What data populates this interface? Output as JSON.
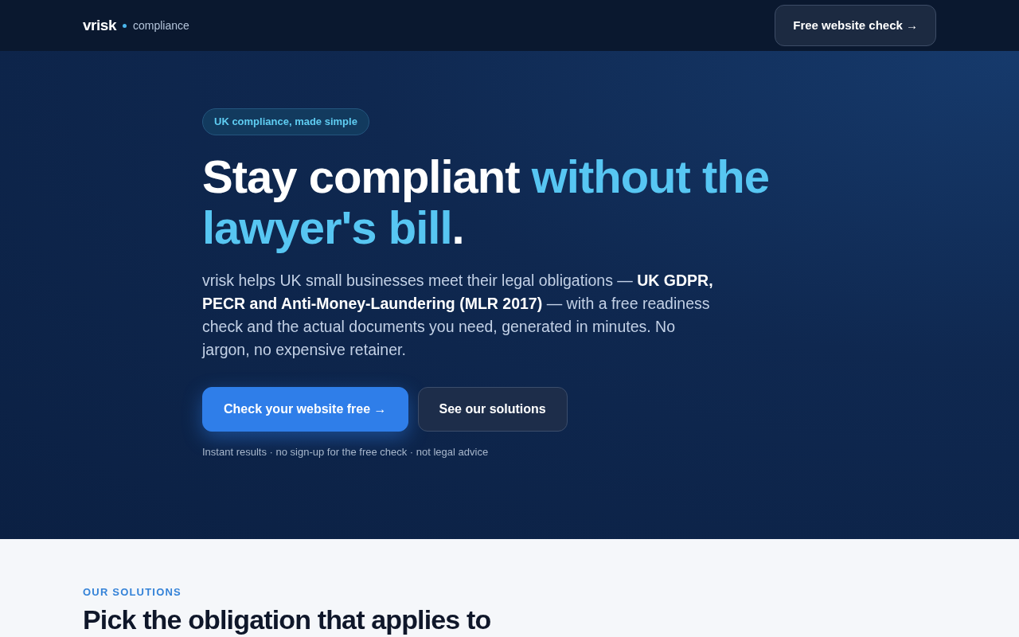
{
  "header": {
    "logo": {
      "brand": "vrisk",
      "product": "compliance"
    },
    "cta": "Free website check →"
  },
  "hero": {
    "badge": "UK compliance, made simple",
    "headline": [
      {
        "text": "Stay compliant ",
        "accent": false
      },
      {
        "text": "without the lawyer's bill",
        "accent": true
      },
      {
        "text": ".",
        "accent": false
      }
    ],
    "intro": "vrisk helps UK small businesses meet their legal obligations — **UK GDPR, PECR and Anti-Money-Laundering (MLR 2017)** — with a free readiness check and the actual documents you need, generated in minutes. No jargon, no expensive retainer.",
    "buttons": [
      {
        "label": "Check your website free →",
        "kind": "primary"
      },
      {
        "label": "See our solutions",
        "kind": "secondary"
      }
    ],
    "note": "Instant results · no sign-up for the free check · not legal advice"
  },
  "solutions": {
    "eyebrow": "OUR SOLUTIONS",
    "heading": "Pick the obligation that applies to"
  }
}
